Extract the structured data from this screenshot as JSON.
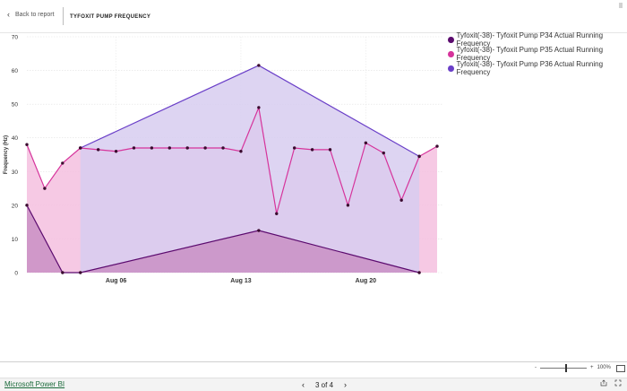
{
  "header": {
    "back_label": "Back to report",
    "title": "TYFOXIT PUMP FREQUENCY"
  },
  "footer": {
    "brand": "Microsoft Power BI",
    "page_indicator": "3 of 4",
    "zoom_level": "100%",
    "zoom_minus": "-",
    "zoom_plus": "+"
  },
  "icons": {
    "back": "chevron-left-icon",
    "prev": "chevron-left-icon",
    "next": "chevron-right-icon",
    "share": "share-icon",
    "expand": "fullscreen-icon",
    "fit": "fit-to-page-icon"
  },
  "chart_data": {
    "type": "area",
    "ylabel": "Frequency (Hz)",
    "xlabel": "",
    "ylim": [
      0,
      70
    ],
    "yticks": [
      0,
      10,
      20,
      30,
      40,
      50,
      60,
      70
    ],
    "xlim": [
      "2023-08-01",
      "2023-08-24"
    ],
    "xticks": [
      {
        "date": "2023-08-06",
        "label": "Aug 06"
      },
      {
        "date": "2023-08-13",
        "label": "Aug 13"
      },
      {
        "date": "2023-08-20",
        "label": "Aug 20"
      }
    ],
    "grid": true,
    "legend_position": "top-right",
    "series": [
      {
        "name": "Tyfoxit(-38)- Tyfoxit Pump P34 Actual Running Frequency",
        "color": "#5b0a6e",
        "fill": "#c98fc4",
        "points": [
          {
            "x": "2023-08-01",
            "y": 20
          },
          {
            "x": "2023-08-03",
            "y": 0
          },
          {
            "x": "2023-08-04",
            "y": 0
          },
          {
            "x": "2023-08-14",
            "y": 12.5
          },
          {
            "x": "2023-08-23",
            "y": 0
          }
        ]
      },
      {
        "name": "Tyfoxit(-38)- Tyfoxit Pump P35 Actual Running Frequency",
        "color": "#d6339b",
        "fill": "#f4bfdf",
        "points": [
          {
            "x": "2023-08-01",
            "y": 38
          },
          {
            "x": "2023-08-02",
            "y": 25
          },
          {
            "x": "2023-08-03",
            "y": 32.5
          },
          {
            "x": "2023-08-04",
            "y": 37
          },
          {
            "x": "2023-08-05",
            "y": 36.5
          },
          {
            "x": "2023-08-06",
            "y": 36
          },
          {
            "x": "2023-08-07",
            "y": 37
          },
          {
            "x": "2023-08-08",
            "y": 37
          },
          {
            "x": "2023-08-09",
            "y": 37
          },
          {
            "x": "2023-08-10",
            "y": 37
          },
          {
            "x": "2023-08-11",
            "y": 37
          },
          {
            "x": "2023-08-12",
            "y": 37
          },
          {
            "x": "2023-08-13",
            "y": 36
          },
          {
            "x": "2023-08-14",
            "y": 49
          },
          {
            "x": "2023-08-15",
            "y": 17.5
          },
          {
            "x": "2023-08-16",
            "y": 37
          },
          {
            "x": "2023-08-17",
            "y": 36.5
          },
          {
            "x": "2023-08-18",
            "y": 36.5
          },
          {
            "x": "2023-08-19",
            "y": 20
          },
          {
            "x": "2023-08-20",
            "y": 38.5
          },
          {
            "x": "2023-08-21",
            "y": 35.5
          },
          {
            "x": "2023-08-22",
            "y": 21.5
          },
          {
            "x": "2023-08-23",
            "y": 34.5
          },
          {
            "x": "2023-08-24",
            "y": 37.5
          }
        ]
      },
      {
        "name": "Tyfoxit(-38)- Tyfoxit Pump P36 Actual Running Frequency",
        "color": "#6a3fc8",
        "fill": "#d7ccf0",
        "points": [
          {
            "x": "2023-08-04",
            "y": 37
          },
          {
            "x": "2023-08-14",
            "y": 61.5
          },
          {
            "x": "2023-08-23",
            "y": 34.5
          }
        ]
      }
    ]
  }
}
